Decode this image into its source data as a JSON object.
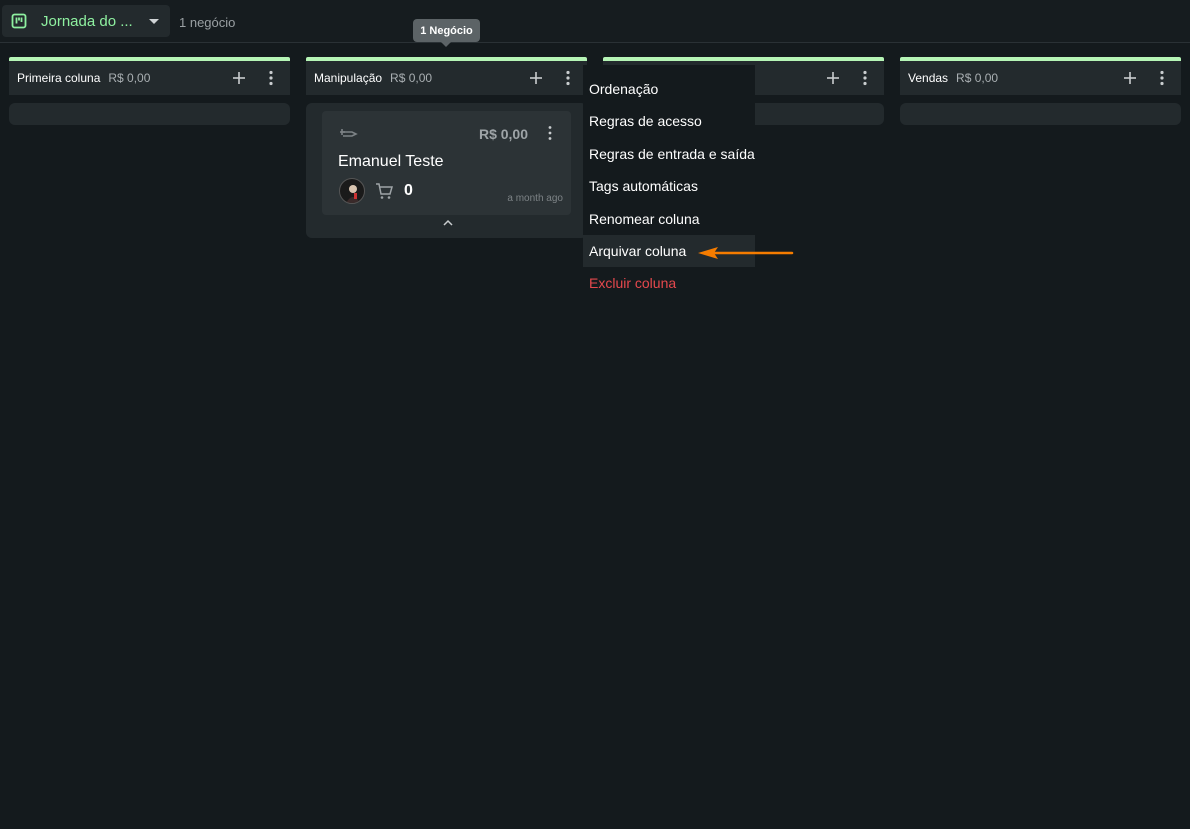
{
  "header": {
    "pipeline_name": "Jornada do ...",
    "deal_count": "1 negócio"
  },
  "tooltip": {
    "text": "1 Negócio"
  },
  "columns": [
    {
      "name": "Primeira coluna",
      "total": "R$ 0,00"
    },
    {
      "name": "Manipulação",
      "total": "R$ 0,00"
    },
    {
      "name": "",
      "total": ""
    },
    {
      "name": "Vendas",
      "total": "R$ 0,00"
    }
  ],
  "card": {
    "value": "R$ 0,00",
    "title": "Emanuel Teste",
    "cart_count": "0",
    "time": "a month ago"
  },
  "column_menu": {
    "items": [
      {
        "label": "Ordenação"
      },
      {
        "label": "Regras de acesso"
      },
      {
        "label": "Regras de entrada e saída"
      },
      {
        "label": "Tags automáticas"
      },
      {
        "label": "Renomear coluna"
      },
      {
        "label": "Arquivar coluna"
      },
      {
        "label": "Excluir coluna"
      }
    ]
  },
  "colors": {
    "background": "#141a1d",
    "accent_green": "#8ef0a0",
    "column_bar": "#b6f5b6",
    "danger": "#e5484d",
    "annotation_arrow": "#f57c00"
  },
  "icons": [
    "board-icon",
    "chevron-down-icon",
    "plus-icon",
    "more-vert-icon",
    "tag-icon",
    "cart-icon",
    "chevron-up-icon",
    "arrow-left-icon"
  ]
}
